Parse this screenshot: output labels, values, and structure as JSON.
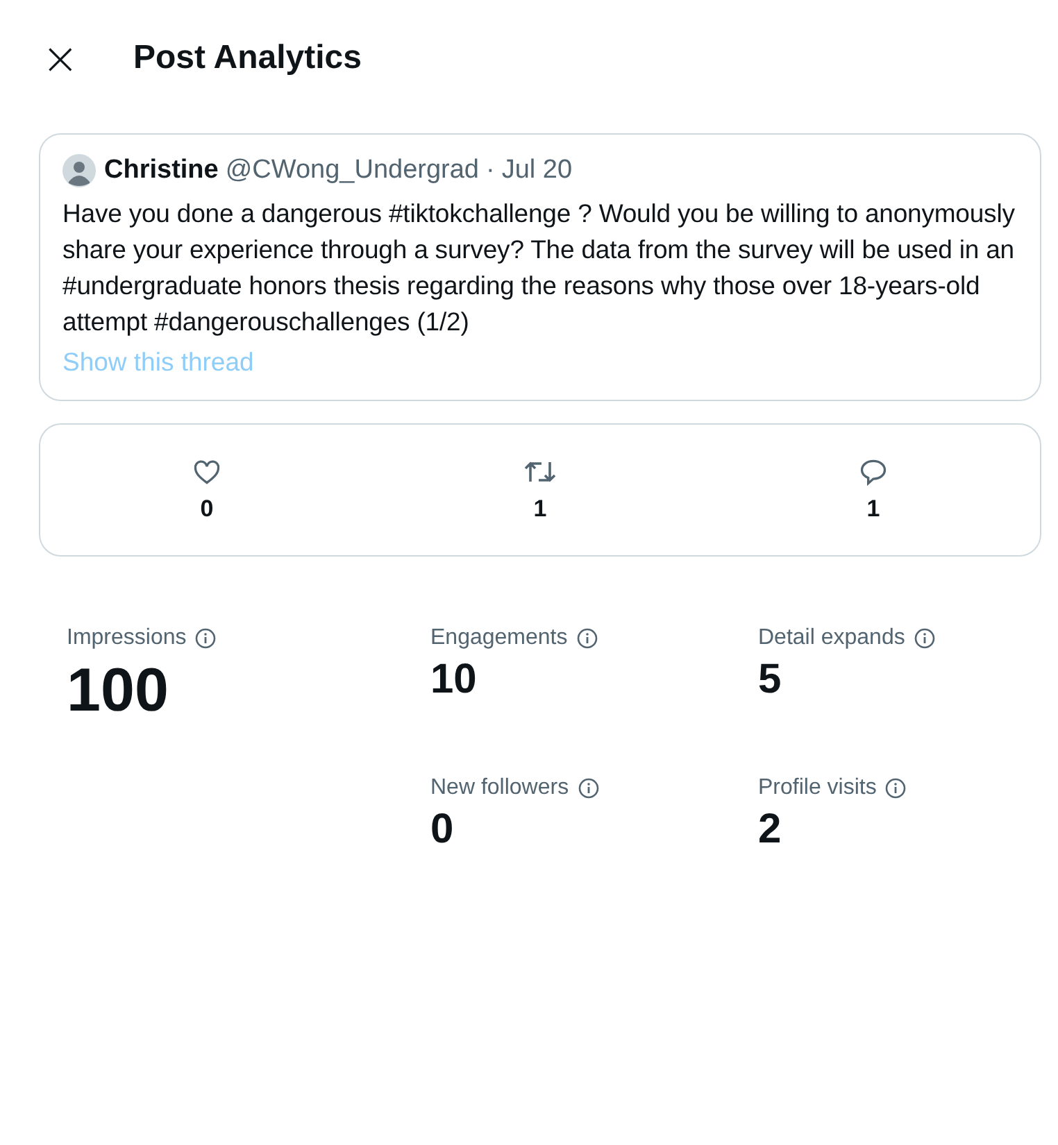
{
  "header": {
    "close": "×",
    "title": "Post Analytics"
  },
  "post": {
    "author": "Christine",
    "handle": "@CWong_Undergrad",
    "separator": "·",
    "date": "Jul 20",
    "text": "Have you done a dangerous #tiktokchallenge ? Would you be willing to anonymously share your experience through a survey? The data from the survey will be used in an #undergraduate honors thesis regarding the reasons why those over 18-years-old attempt #dangerouschallenges (1/2)",
    "thread_link": "Show this thread"
  },
  "interactions": [
    {
      "kind": "like",
      "count": "0"
    },
    {
      "kind": "repost",
      "count": "1"
    },
    {
      "kind": "reply",
      "count": "1"
    }
  ],
  "primary_metric": {
    "label": "Impressions",
    "value": "100"
  },
  "metrics": [
    {
      "label": "Engagements",
      "value": "10"
    },
    {
      "label": "Detail expands",
      "value": "5"
    },
    {
      "label": "New followers",
      "value": "0"
    },
    {
      "label": "Profile visits",
      "value": "2"
    }
  ]
}
